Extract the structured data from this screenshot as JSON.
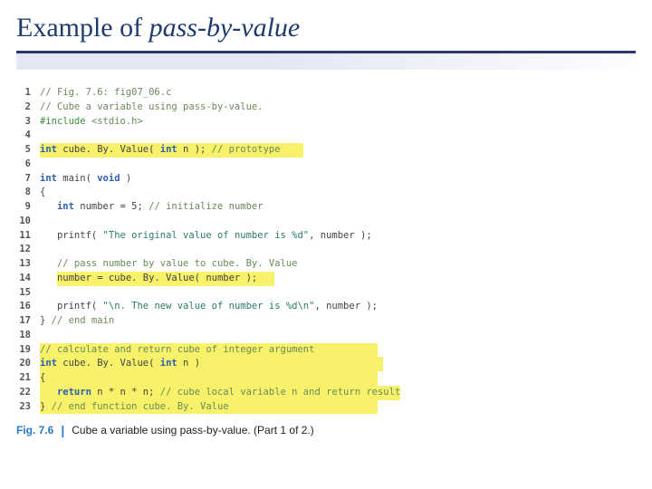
{
  "title_prefix": "Example of ",
  "title_italic": "pass-by-value",
  "code": {
    "lines": [
      {
        "n": "1",
        "frags": [
          {
            "cls": "c-comment",
            "t": "// Fig. 7.6: fig07_06.c"
          }
        ]
      },
      {
        "n": "2",
        "frags": [
          {
            "cls": "c-comment",
            "t": "// Cube a variable using pass-by-value."
          }
        ]
      },
      {
        "n": "3",
        "frags": [
          {
            "cls": "c-pp",
            "t": "#include "
          },
          {
            "cls": "c-comment",
            "t": "<stdio.h>"
          }
        ]
      },
      {
        "n": "4",
        "frags": [
          {
            "cls": "",
            "t": ""
          }
        ]
      },
      {
        "n": "5",
        "hl": true,
        "frags": [
          {
            "cls": "c-kw",
            "t": "int"
          },
          {
            "cls": "",
            "t": " cube. By. Value( "
          },
          {
            "cls": "c-kw",
            "t": "int"
          },
          {
            "cls": "",
            "t": " n ); "
          },
          {
            "cls": "c-comment",
            "t": "// prototype    "
          }
        ]
      },
      {
        "n": "6",
        "frags": [
          {
            "cls": "",
            "t": ""
          }
        ]
      },
      {
        "n": "7",
        "frags": [
          {
            "cls": "c-kw",
            "t": "int"
          },
          {
            "cls": "",
            "t": " main( "
          },
          {
            "cls": "c-kw",
            "t": "void"
          },
          {
            "cls": "",
            "t": " )"
          }
        ]
      },
      {
        "n": "8",
        "frags": [
          {
            "cls": "",
            "t": "{"
          }
        ]
      },
      {
        "n": "9",
        "frags": [
          {
            "cls": "",
            "t": "   "
          },
          {
            "cls": "c-kw",
            "t": "int"
          },
          {
            "cls": "",
            "t": " number = 5; "
          },
          {
            "cls": "c-comment",
            "t": "// initialize number"
          }
        ]
      },
      {
        "n": "10",
        "frags": [
          {
            "cls": "",
            "t": ""
          }
        ]
      },
      {
        "n": "11",
        "frags": [
          {
            "cls": "",
            "t": "   printf( "
          },
          {
            "cls": "c-str",
            "t": "\"The original value of number is %d\""
          },
          {
            "cls": "",
            "t": ", number );"
          }
        ]
      },
      {
        "n": "12",
        "frags": [
          {
            "cls": "",
            "t": ""
          }
        ]
      },
      {
        "n": "13",
        "frags": [
          {
            "cls": "",
            "t": "   "
          },
          {
            "cls": "c-comment",
            "t": "// pass number by value to cube. By. Value"
          }
        ]
      },
      {
        "n": "14",
        "hl": true,
        "indent": "   ",
        "frags": [
          {
            "cls": "",
            "t": "number = cube. By. Value( number );   "
          }
        ]
      },
      {
        "n": "15",
        "frags": [
          {
            "cls": "",
            "t": ""
          }
        ]
      },
      {
        "n": "16",
        "frags": [
          {
            "cls": "",
            "t": "   printf( "
          },
          {
            "cls": "c-str",
            "t": "\"\\n. The new value of number is %d\\n\""
          },
          {
            "cls": "",
            "t": ", number );"
          }
        ]
      },
      {
        "n": "17",
        "frags": [
          {
            "cls": "",
            "t": "} "
          },
          {
            "cls": "c-comment",
            "t": "// end main"
          }
        ]
      },
      {
        "n": "18",
        "frags": [
          {
            "cls": "",
            "t": ""
          }
        ]
      },
      {
        "n": "19",
        "hl": true,
        "frags": [
          {
            "cls": "c-comment",
            "t": "// calculate and return cube of integer argument           "
          }
        ]
      },
      {
        "n": "20",
        "hl": true,
        "frags": [
          {
            "cls": "c-kw",
            "t": "int"
          },
          {
            "cls": "",
            "t": " cube. By. Value( "
          },
          {
            "cls": "c-kw",
            "t": "int"
          },
          {
            "cls": "",
            "t": " n )                                "
          }
        ]
      },
      {
        "n": "21",
        "hl": true,
        "frags": [
          {
            "cls": "",
            "t": "{                                                          "
          }
        ]
      },
      {
        "n": "22",
        "hl": true,
        "frags": [
          {
            "cls": "",
            "t": "   "
          },
          {
            "cls": "c-kw",
            "t": "return"
          },
          {
            "cls": "",
            "t": " n * n * n; "
          },
          {
            "cls": "c-comment",
            "t": "// cube local variable n and return result"
          }
        ]
      },
      {
        "n": "23",
        "hl": true,
        "frags": [
          {
            "cls": "",
            "t": "} "
          },
          {
            "cls": "c-comment",
            "t": "// end function cube. By. Value                          "
          }
        ]
      }
    ]
  },
  "caption": {
    "fig": "Fig. 7.6",
    "sep": "|",
    "text": "Cube a variable using pass-by-value. (Part 1 of 2.)"
  }
}
